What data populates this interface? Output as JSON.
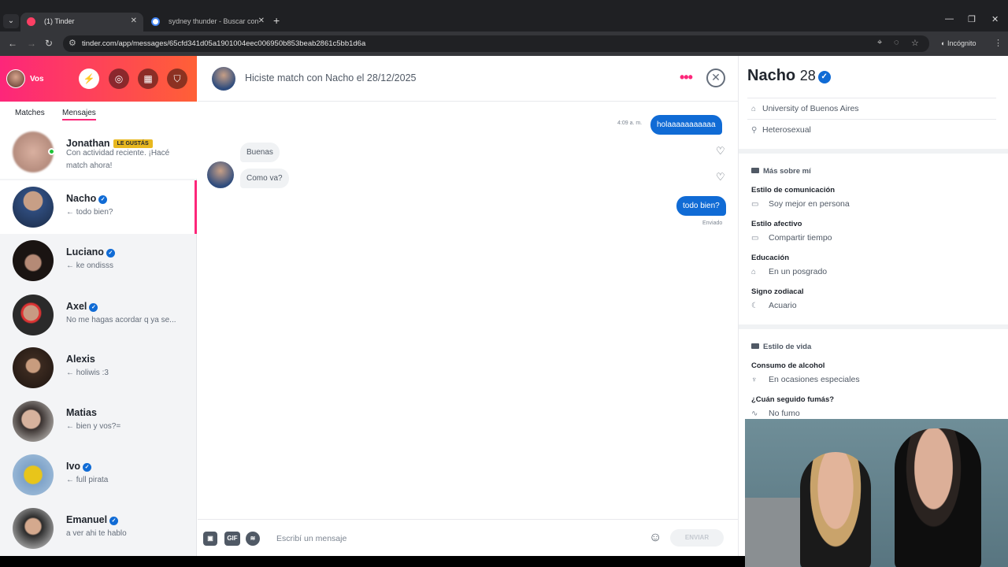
{
  "browser": {
    "tabs": [
      {
        "title": "(1) Tinder",
        "active": true
      },
      {
        "title": "sydney thunder - Buscar con G...",
        "active": false
      }
    ],
    "url": "tinder.com/app/messages/65cfd341d05a1901004eec006950b853beab2861c5bb1d6a",
    "incognito_label": "Incógnito",
    "accent": "#fd267a"
  },
  "sidebar": {
    "me_label": "Vos",
    "tabs": [
      "Matches",
      "Mensajes"
    ],
    "conversations": [
      {
        "name": "Jonathan",
        "badge": "LE GUSTÁS",
        "preview": "Con actividad reciente. ¡Hacé match ahora!",
        "verified": false
      },
      {
        "name": "Nacho",
        "preview": "← todo bien?",
        "verified": true
      },
      {
        "name": "Luciano",
        "preview": "← ke ondisss",
        "verified": true
      },
      {
        "name": "Axel",
        "preview": "No me hagas acordar q ya se...",
        "verified": true
      },
      {
        "name": "Alexis",
        "preview": "← holiwis :3",
        "verified": false
      },
      {
        "name": "Matias",
        "preview": "← bien y vos?=",
        "verified": false
      },
      {
        "name": "Ivo",
        "preview": "← full pirata",
        "verified": true
      },
      {
        "name": "Emanuel",
        "preview": "a ver ahi te hablo",
        "verified": true
      }
    ]
  },
  "chat": {
    "header": "Hiciste match con Nacho el 28/12/2025",
    "messages": [
      {
        "from": "me",
        "text": "holaaaaaaaaaaa",
        "time": "4:09 a. m."
      },
      {
        "from": "them",
        "text": "Buenas"
      },
      {
        "from": "them",
        "text": "Como va?"
      },
      {
        "from": "me",
        "text": "todo bien?",
        "status": "Enviado"
      }
    ],
    "composer": {
      "placeholder": "Escribí un mensaje",
      "gif_label": "GIF",
      "send_label": "ENVIAR"
    }
  },
  "profile": {
    "name": "Nacho",
    "age": "28",
    "basics": [
      {
        "icon": "education-icon",
        "text": "University of Buenos Aires"
      },
      {
        "icon": "orientation-icon",
        "text": "Heterosexual"
      }
    ],
    "more_about_title": "Más sobre mí",
    "more_about": [
      {
        "label": "Estilo de comunicación",
        "value": "Soy mejor en persona"
      },
      {
        "label": "Estilo afectivo",
        "value": "Compartir tiempo"
      },
      {
        "label": "Educación",
        "value": "En un posgrado"
      },
      {
        "label": "Signo zodiacal",
        "value": "Acuario"
      }
    ],
    "lifestyle_title": "Estilo de vida",
    "lifestyle": [
      {
        "label": "Consumo de alcohol",
        "value": "En ocasiones especiales"
      },
      {
        "label": "¿Cuán seguido fumás?",
        "value": "No fumo"
      }
    ]
  }
}
